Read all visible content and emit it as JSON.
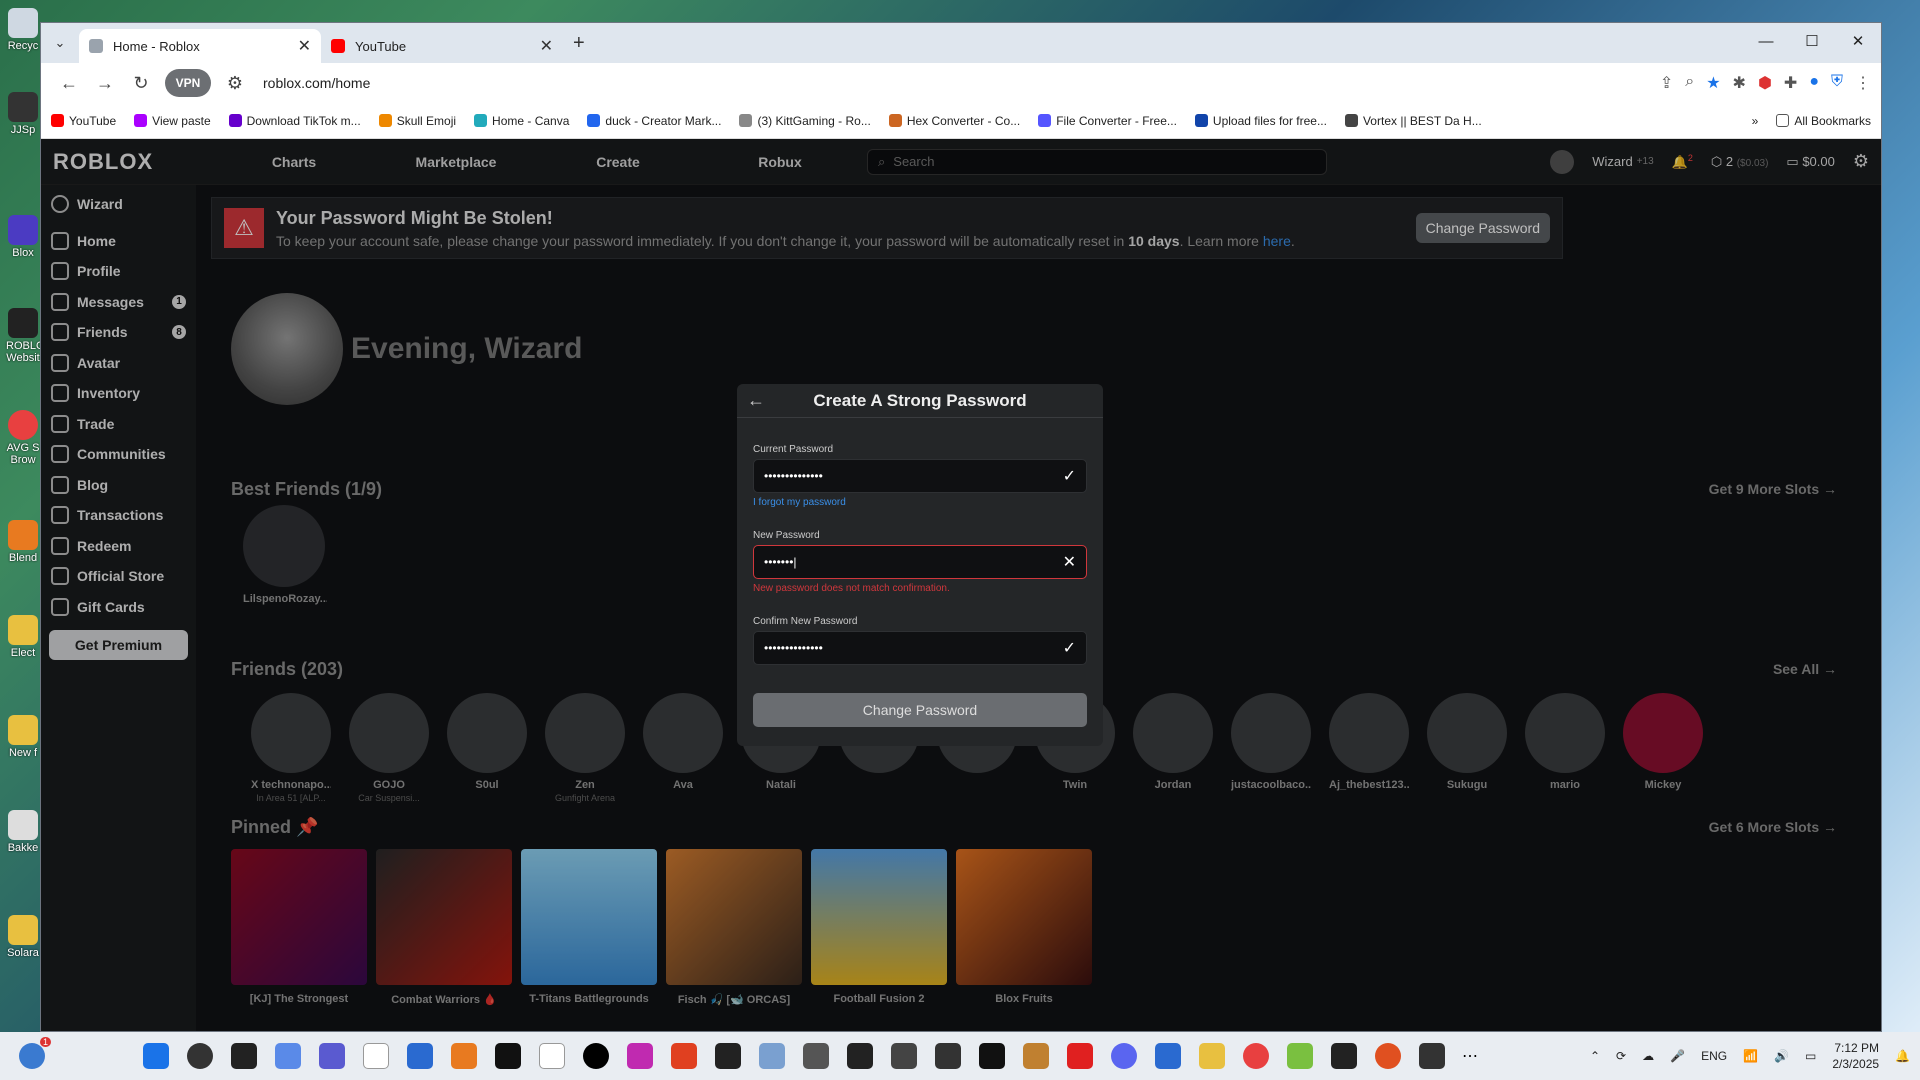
{
  "desktop": {
    "icons": [
      "Recyc",
      "JJSp",
      "Blox",
      "ROBLO Websit",
      "AVG S Brow",
      "Blend",
      "Elect",
      "New f",
      "Bakke",
      "Solara"
    ]
  },
  "browser": {
    "tabs": [
      {
        "label": "Home - Roblox",
        "active": true
      },
      {
        "label": "YouTube",
        "active": false
      }
    ],
    "new_tab": "+",
    "url": "roblox.com/home",
    "vpn_label": "VPN",
    "bookmarks": [
      "YouTube",
      "View paste",
      "Download TikTok m...",
      "Skull Emoji",
      "Home - Canva",
      "duck - Creator Mark...",
      "(3) KittGaming - Ro...",
      "Hex Converter - Co...",
      "File Converter - Free...",
      "Upload files for free...",
      "Vortex || BEST Da H..."
    ],
    "all_bookmarks": "All Bookmarks"
  },
  "roblox": {
    "logo": "ROBLOX",
    "nav": [
      "Charts",
      "Marketplace",
      "Create",
      "Robux"
    ],
    "search_placeholder": "Search",
    "user": "Wizard",
    "age_label": "+13",
    "notifications": "2",
    "robux": "2",
    "robux_sub": "($0.03)",
    "balance": "$0.00",
    "sidebar": {
      "user": "Wizard",
      "items": [
        {
          "label": "Home",
          "badge": ""
        },
        {
          "label": "Profile",
          "badge": ""
        },
        {
          "label": "Messages",
          "badge": "1"
        },
        {
          "label": "Friends",
          "badge": "8"
        },
        {
          "label": "Avatar",
          "badge": ""
        },
        {
          "label": "Inventory",
          "badge": ""
        },
        {
          "label": "Trade",
          "badge": ""
        },
        {
          "label": "Communities",
          "badge": ""
        },
        {
          "label": "Blog",
          "badge": ""
        },
        {
          "label": "Transactions",
          "badge": ""
        },
        {
          "label": "Redeem",
          "badge": ""
        },
        {
          "label": "Official Store",
          "badge": ""
        },
        {
          "label": "Gift Cards",
          "badge": ""
        }
      ],
      "premium": "Get Premium"
    },
    "alert": {
      "title": "Your Password Might Be Stolen!",
      "body_pre": "To keep your account safe, please change your password immediately. If you don't change it, your password will be automatically reset in ",
      "body_bold": "10 days",
      "body_post": ". Learn more ",
      "link": "here",
      "link_end": ".",
      "button": "Change Password"
    },
    "greeting": "Evening, Wizard",
    "best_friends": {
      "title": "Best Friends (1/9)",
      "more": "Get 9 More Slots →",
      "names": [
        "LilspenoRozay..."
      ]
    },
    "friends": {
      "title": "Friends (203)",
      "more": "See All →",
      "list": [
        {
          "name": "X technonapo...",
          "status": "In Area 51 [ALP..."
        },
        {
          "name": "GOJO",
          "status": "Car Suspensi..."
        },
        {
          "name": "S0ul",
          "status": ""
        },
        {
          "name": "Zen",
          "status": "Gunfight Arena"
        },
        {
          "name": "Ava",
          "status": ""
        },
        {
          "name": "Natali",
          "status": ""
        },
        {
          "name": "",
          "status": ""
        },
        {
          "name": "",
          "status": ""
        },
        {
          "name": "Twin",
          "status": ""
        },
        {
          "name": "Jordan",
          "status": ""
        },
        {
          "name": "justacoolbaco...",
          "status": ""
        },
        {
          "name": "Aj_thebest123...",
          "status": ""
        },
        {
          "name": "Sukugu",
          "status": ""
        },
        {
          "name": "mario",
          "status": ""
        },
        {
          "name": "Mickey",
          "status": ""
        }
      ]
    },
    "pinned": {
      "title": "Pinned 📌",
      "more": "Get 6 More Slots →",
      "games": [
        "[KJ] The Strongest",
        "Combat Warriors 🩸",
        "T-Titans Battlegrounds",
        "Fisch 🎣 [🐋 ORCAS]",
        "Football Fusion 2",
        "Blox Fruits"
      ]
    },
    "modal": {
      "title": "Create A Strong Password",
      "current_label": "Current Password",
      "current_value": "••••••••••••••",
      "forgot": "I forgot my password",
      "new_label": "New Password",
      "new_value": "•••••••|",
      "error": "New password does not match confirmation.",
      "confirm_label": "Confirm New Password",
      "confirm_value": "••••••••••••••",
      "button": "Change Password"
    }
  },
  "taskbar": {
    "lang": "ENG",
    "time": "7:12 PM",
    "date": "2/3/2025",
    "badge": "1"
  }
}
